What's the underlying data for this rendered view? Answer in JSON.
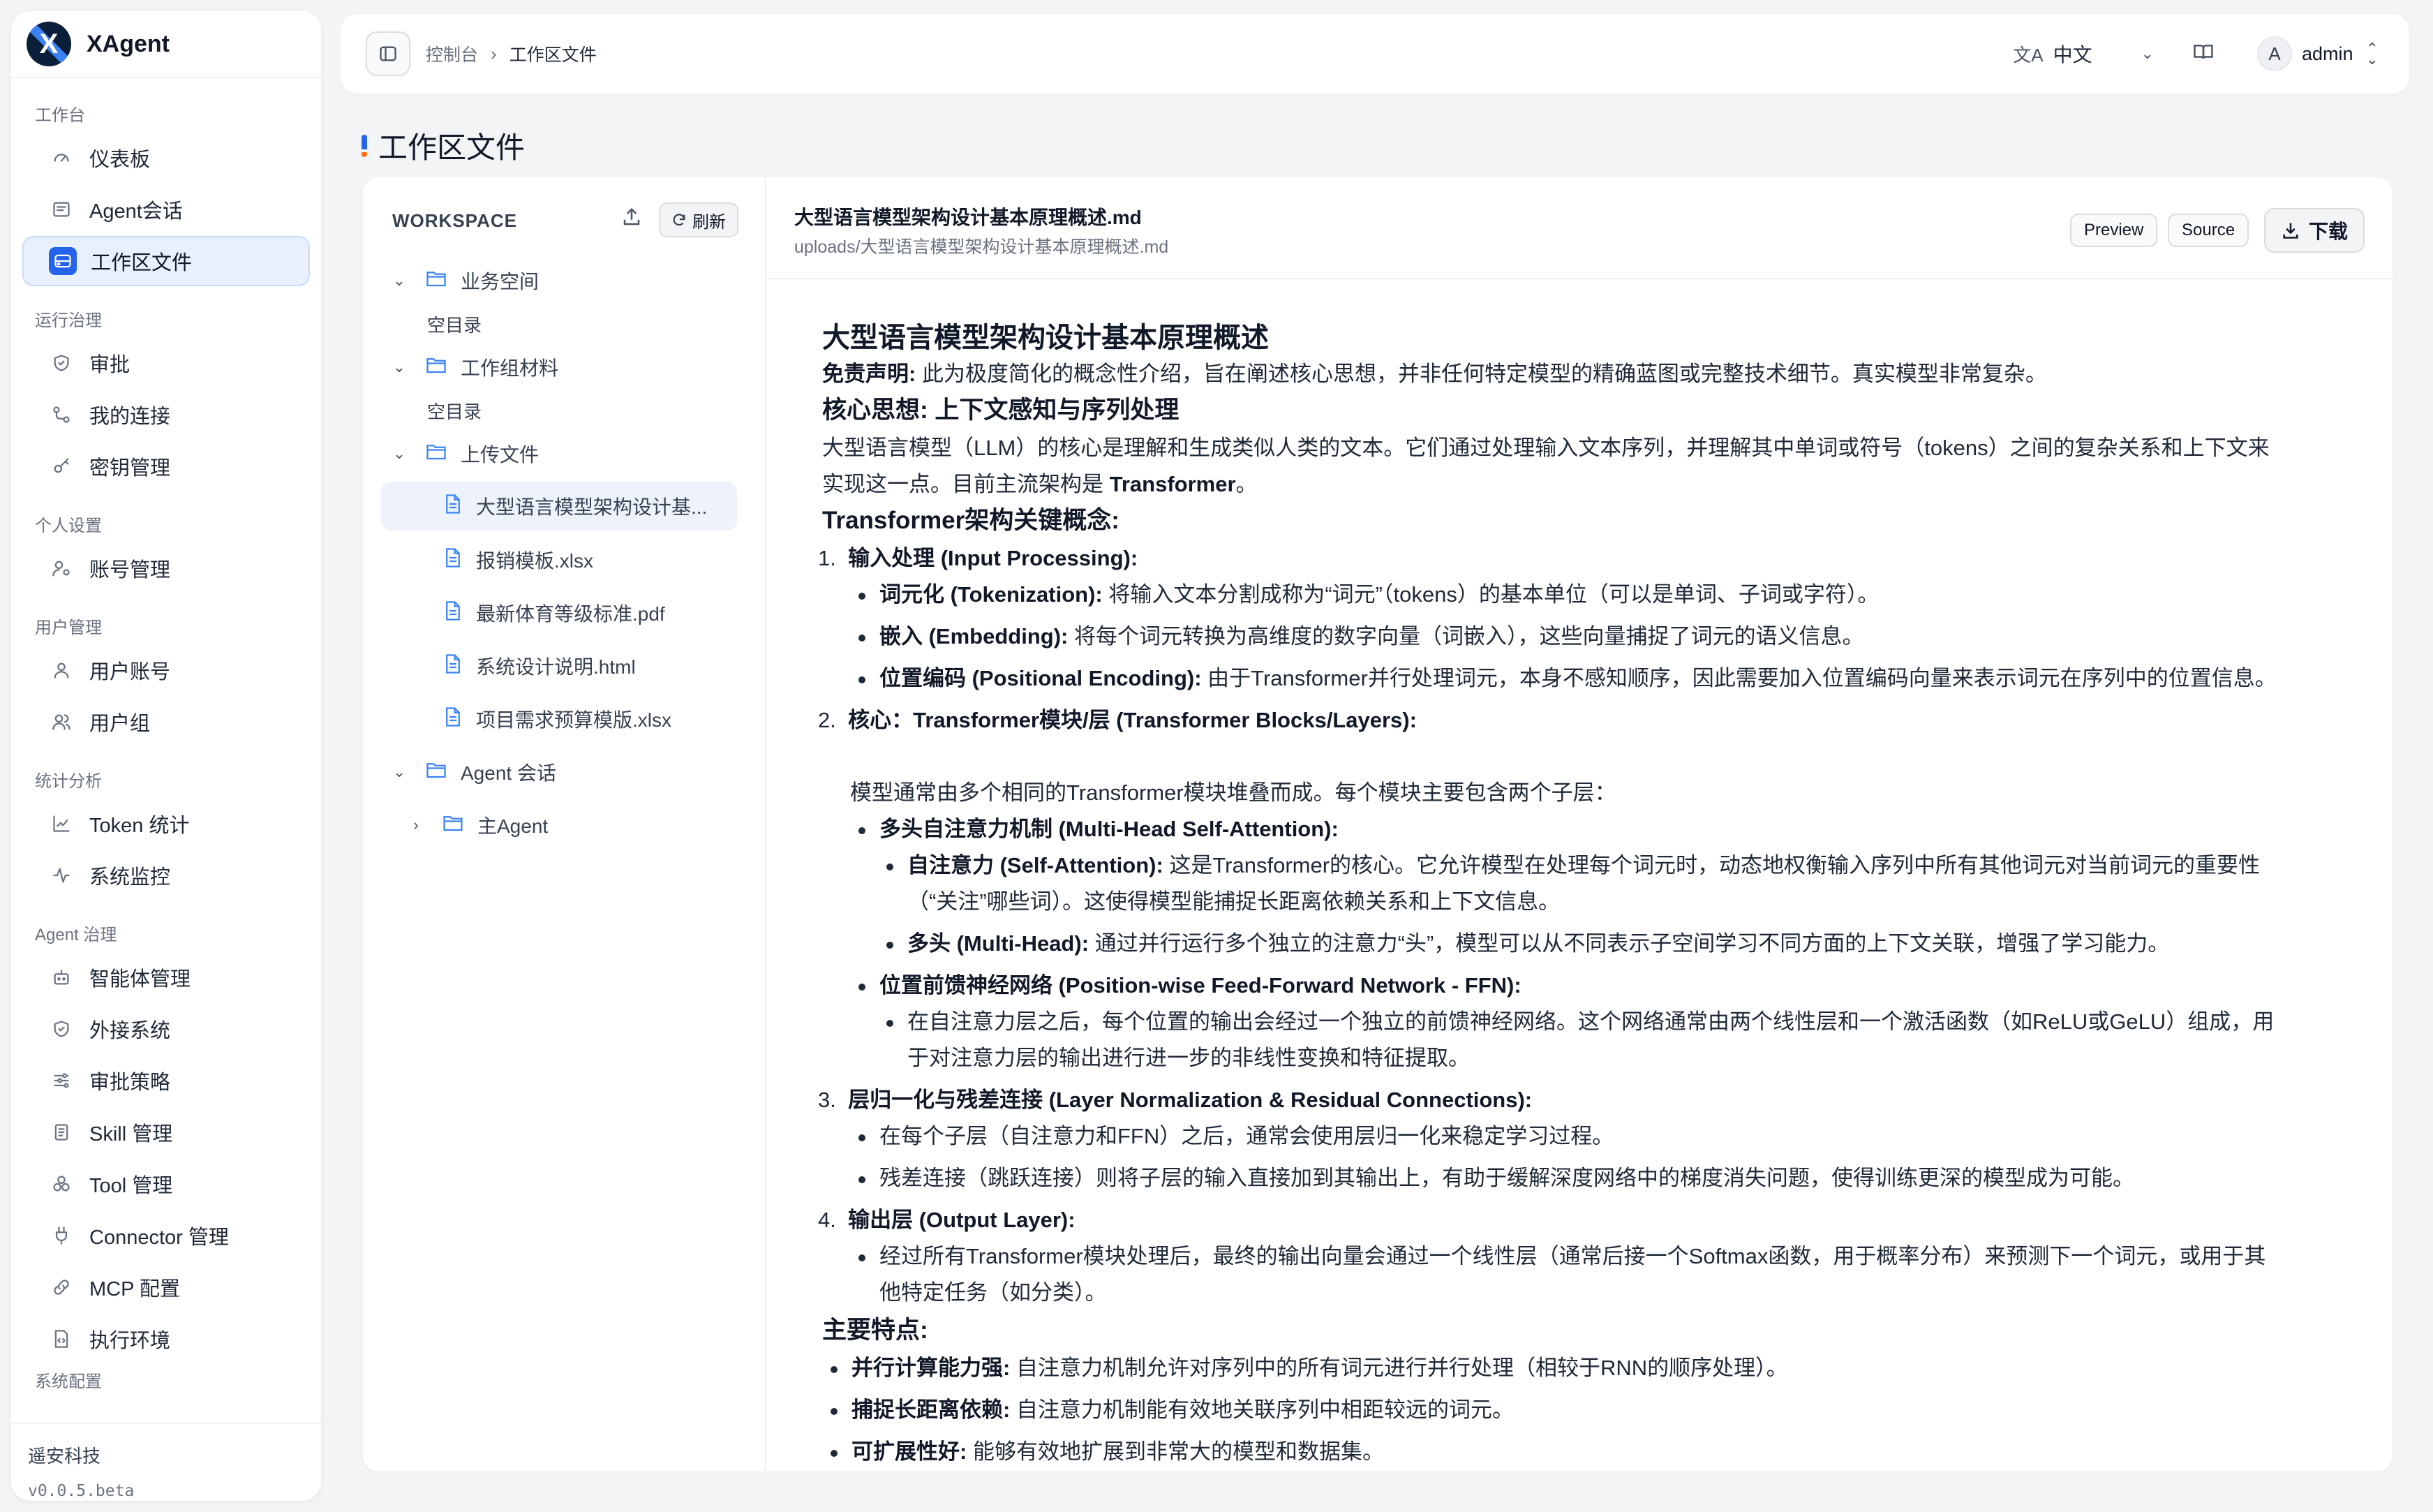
{
  "brand": {
    "name": "XAgent",
    "logo_letter": "X"
  },
  "sidebar": {
    "groups": [
      {
        "label": "工作台",
        "items": [
          {
            "label": "仪表板",
            "icon": "gauge-icon"
          },
          {
            "label": "Agent会话",
            "icon": "chat-list-icon"
          },
          {
            "label": "工作区文件",
            "icon": "drive-icon",
            "active": true
          }
        ]
      },
      {
        "label": "运行治理",
        "items": [
          {
            "label": "审批",
            "icon": "shield-check-icon"
          },
          {
            "label": "我的连接",
            "icon": "link-icon"
          },
          {
            "label": "密钥管理",
            "icon": "key-icon"
          }
        ]
      },
      {
        "label": "个人设置",
        "items": [
          {
            "label": "账号管理",
            "icon": "user-cog-icon"
          }
        ]
      },
      {
        "label": "用户管理",
        "items": [
          {
            "label": "用户账号",
            "icon": "user-icon"
          },
          {
            "label": "用户组",
            "icon": "users-icon"
          }
        ]
      },
      {
        "label": "统计分析",
        "items": [
          {
            "label": "Token 统计",
            "icon": "line-chart-icon"
          },
          {
            "label": "系统监控",
            "icon": "activity-icon"
          }
        ]
      },
      {
        "label": "Agent 治理",
        "items": [
          {
            "label": "智能体管理",
            "icon": "bot-icon"
          },
          {
            "label": "外接系统",
            "icon": "shield-icon"
          },
          {
            "label": "审批策略",
            "icon": "sliders-icon"
          },
          {
            "label": "Skill 管理",
            "icon": "file-list-icon"
          },
          {
            "label": "Tool 管理",
            "icon": "tools-icon"
          },
          {
            "label": "Connector 管理",
            "icon": "plug-icon"
          },
          {
            "label": "MCP 配置",
            "icon": "chain-icon"
          },
          {
            "label": "执行环境",
            "icon": "file-code-icon"
          }
        ]
      }
    ],
    "cut_group": "系统配置",
    "footer": {
      "company": "遥安科技",
      "version": "v0.0.5.beta"
    }
  },
  "header": {
    "breadcrumb": [
      "控制台",
      "工作区文件"
    ],
    "lang": "中文",
    "user": "admin",
    "avatar_letter": "A"
  },
  "page": {
    "title": "工作区文件"
  },
  "tree": {
    "title": "WORKSPACE",
    "refresh_label": "刷新",
    "nodes": {
      "business": "业务空间",
      "empty1": "空目录",
      "group_material": "工作组材料",
      "empty2": "空目录",
      "uploads": "上传文件",
      "files": [
        "大型语言模型架构设计基...",
        "报销模板.xlsx",
        "最新体育等级标准.pdf",
        "系统设计说明.html",
        "项目需求预算模版.xlsx"
      ],
      "agent_sessions": "Agent 会话",
      "main_agent": "主Agent"
    }
  },
  "viewer": {
    "file_name": "大型语言模型架构设计基本原理概述.md",
    "file_path": "uploads/大型语言模型架构设计基本原理概述.md",
    "preview_label": "Preview",
    "source_label": "Source",
    "download_label": "下载"
  },
  "doc": {
    "title": "大型语言模型架构设计基本原理概述",
    "disclaimer_label": "免责声明:",
    "disclaimer": " 此为极度简化的概念性介绍，旨在阐述核心思想，并非任何特定模型的精确蓝图或完整技术细节。真实模型非常复杂。",
    "h_core": "核心思想: 上下文感知与序列处理",
    "core_p1": "大型语言模型（LLM）的核心是理解和生成类似人类的文本。它们通过处理输入文本序列，并理解其中单词或符号（tokens）之间的复杂关系和上下文来",
    "core_p2a": "实现这一点。目前主流架构是 ",
    "core_p2b": "Transformer",
    "core_p2c": "。",
    "h_transformer": "Transformer架构关键概念:",
    "n1": "1.",
    "n1_title": "输入处理 (Input Processing):",
    "n1_a_label": "词元化 (Tokenization):",
    "n1_a": " 将输入文本分割成称为“词元”（tokens）的基本单位（可以是单词、子词或字符）。",
    "n1_b_label": "嵌入 (Embedding):",
    "n1_b": " 将每个词元转换为高维度的数字向量（词嵌入），这些向量捕捉了词元的语义信息。",
    "n1_c_label": "位置编码 (Positional Encoding):",
    "n1_c": " 由于Transformer并行处理词元，本身不感知顺序，因此需要加入位置编码向量来表示词元在序列中的位置信息。",
    "n2": "2.",
    "n2_title_a": "核心：",
    "n2_title_b": "Transformer模块/层 (Transformer Blocks/Layers):",
    "n2_p": "模型通常由多个相同的Transformer模块堆叠而成。每个模块主要包含两个子层：",
    "mha_label": "多头自注意力机制 (Multi-Head Self-Attention):",
    "sa_label": "自注意力 (Self-Attention):",
    "sa_1": " 这是Transformer的核心。它允许模型在处理每个词元时，动态地权衡输入序列中所有其他词元对当前词元的重要性",
    "sa_2": "（“关注”哪些词）。这使得模型能捕捉长距离依赖关系和上下文信息。",
    "mh_label": "多头 (Multi-Head):",
    "mh": " 通过并行运行多个独立的注意力“头”，模型可以从不同表示子空间学习不同方面的上下文关联，增强了学习能力。",
    "ffn_label": "位置前馈神经网络 (Position-wise Feed-Forward Network - FFN):",
    "ffn_1": "在自注意力层之后，每个位置的输出会经过一个独立的前馈神经网络。这个网络通常由两个线性层和一个激活函数（如ReLU或GeLU）组成，用",
    "ffn_2": "于对注意力层的输出进行进一步的非线性变换和特征提取。",
    "n3": "3.",
    "n3_title": "层归一化与残差连接 (Layer Normalization & Residual Connections):",
    "n3_a": "在每个子层（自注意力和FFN）之后，通常会使用层归一化来稳定学习过程。",
    "n3_b": "残差连接（跳跃连接）则将子层的输入直接加到其输出上，有助于缓解深度网络中的梯度消失问题，使得训练更深的模型成为可能。",
    "n4": "4.",
    "n4_title": "输出层 (Output Layer):",
    "n4_a1": "经过所有Transformer模块处理后，最终的输出向量会通过一个线性层（通常后接一个Softmax函数，用于概率分布）来预测下一个词元，或用于其",
    "n4_a2": "他特定任务（如分类）。",
    "h_features": "主要特点:",
    "f1_label": "并行计算能力强:",
    "f1": " 自注意力机制允许对序列中的所有词元进行并行处理（相较于RNN的顺序处理）。",
    "f2_label": "捕捉长距离依赖:",
    "f2": " 自注意力机制能有效地关联序列中相距较远的词元。",
    "f3_label": "可扩展性好:",
    "f3": " 能够有效地扩展到非常大的模型和数据集。"
  }
}
